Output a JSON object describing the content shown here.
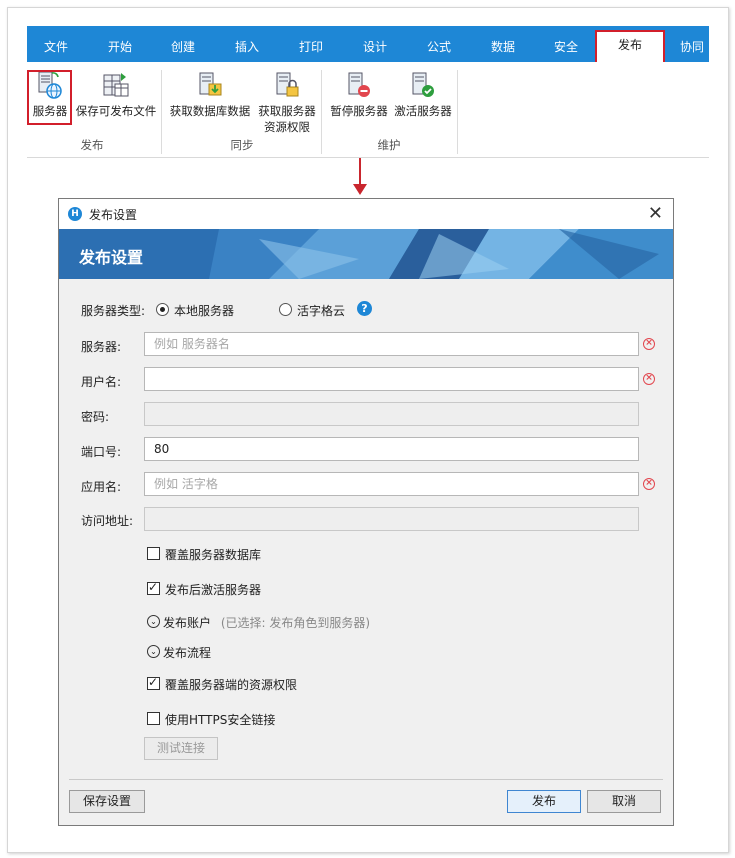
{
  "ribbon": {
    "tabs": [
      "文件",
      "开始",
      "创建",
      "插入",
      "打印",
      "设计",
      "公式",
      "数据",
      "安全",
      "发布",
      "协同"
    ],
    "active_tab": "发布",
    "buttons": {
      "server": "服务器",
      "save_publishable": "保存可发布文件",
      "get_db_data": "获取数据库数据",
      "get_server_perm_1": "获取服务器",
      "get_server_perm_2": "资源权限",
      "pause_server": "暂停服务器",
      "activate_server": "激活服务器"
    },
    "groups": {
      "publish": "发布",
      "sync": "同步",
      "maintain": "维护"
    }
  },
  "dialog": {
    "window_title": "发布设置",
    "banner_title": "发布设置",
    "server_type_label": "服务器类型:",
    "server_type_local": "本地服务器",
    "server_type_cloud": "活字格云",
    "server_type_selected": "本地服务器",
    "server_label": "服务器:",
    "server_placeholder": "例如 服务器名",
    "username_label": "用户名:",
    "username_value": "",
    "password_label": "密码:",
    "port_label": "端口号:",
    "port_value": "80",
    "appname_label": "应用名:",
    "appname_placeholder": "例如 活字格",
    "url_label": "访问地址:",
    "url_value": "",
    "cb_overwrite_db": "覆盖服务器数据库",
    "cb_overwrite_db_checked": false,
    "cb_activate_after": "发布后激活服务器",
    "cb_activate_after_checked": true,
    "publish_accounts": "发布账户",
    "publish_accounts_hint": "(已选择: 发布角色到服务器)",
    "publish_flow": "发布流程",
    "cb_overwrite_perm": "覆盖服务器端的资源权限",
    "cb_overwrite_perm_checked": true,
    "cb_https": "使用HTTPS安全链接",
    "cb_https_checked": false,
    "test_connection": "测试连接",
    "save_settings": "保存设置",
    "publish": "发布",
    "cancel": "取消"
  }
}
